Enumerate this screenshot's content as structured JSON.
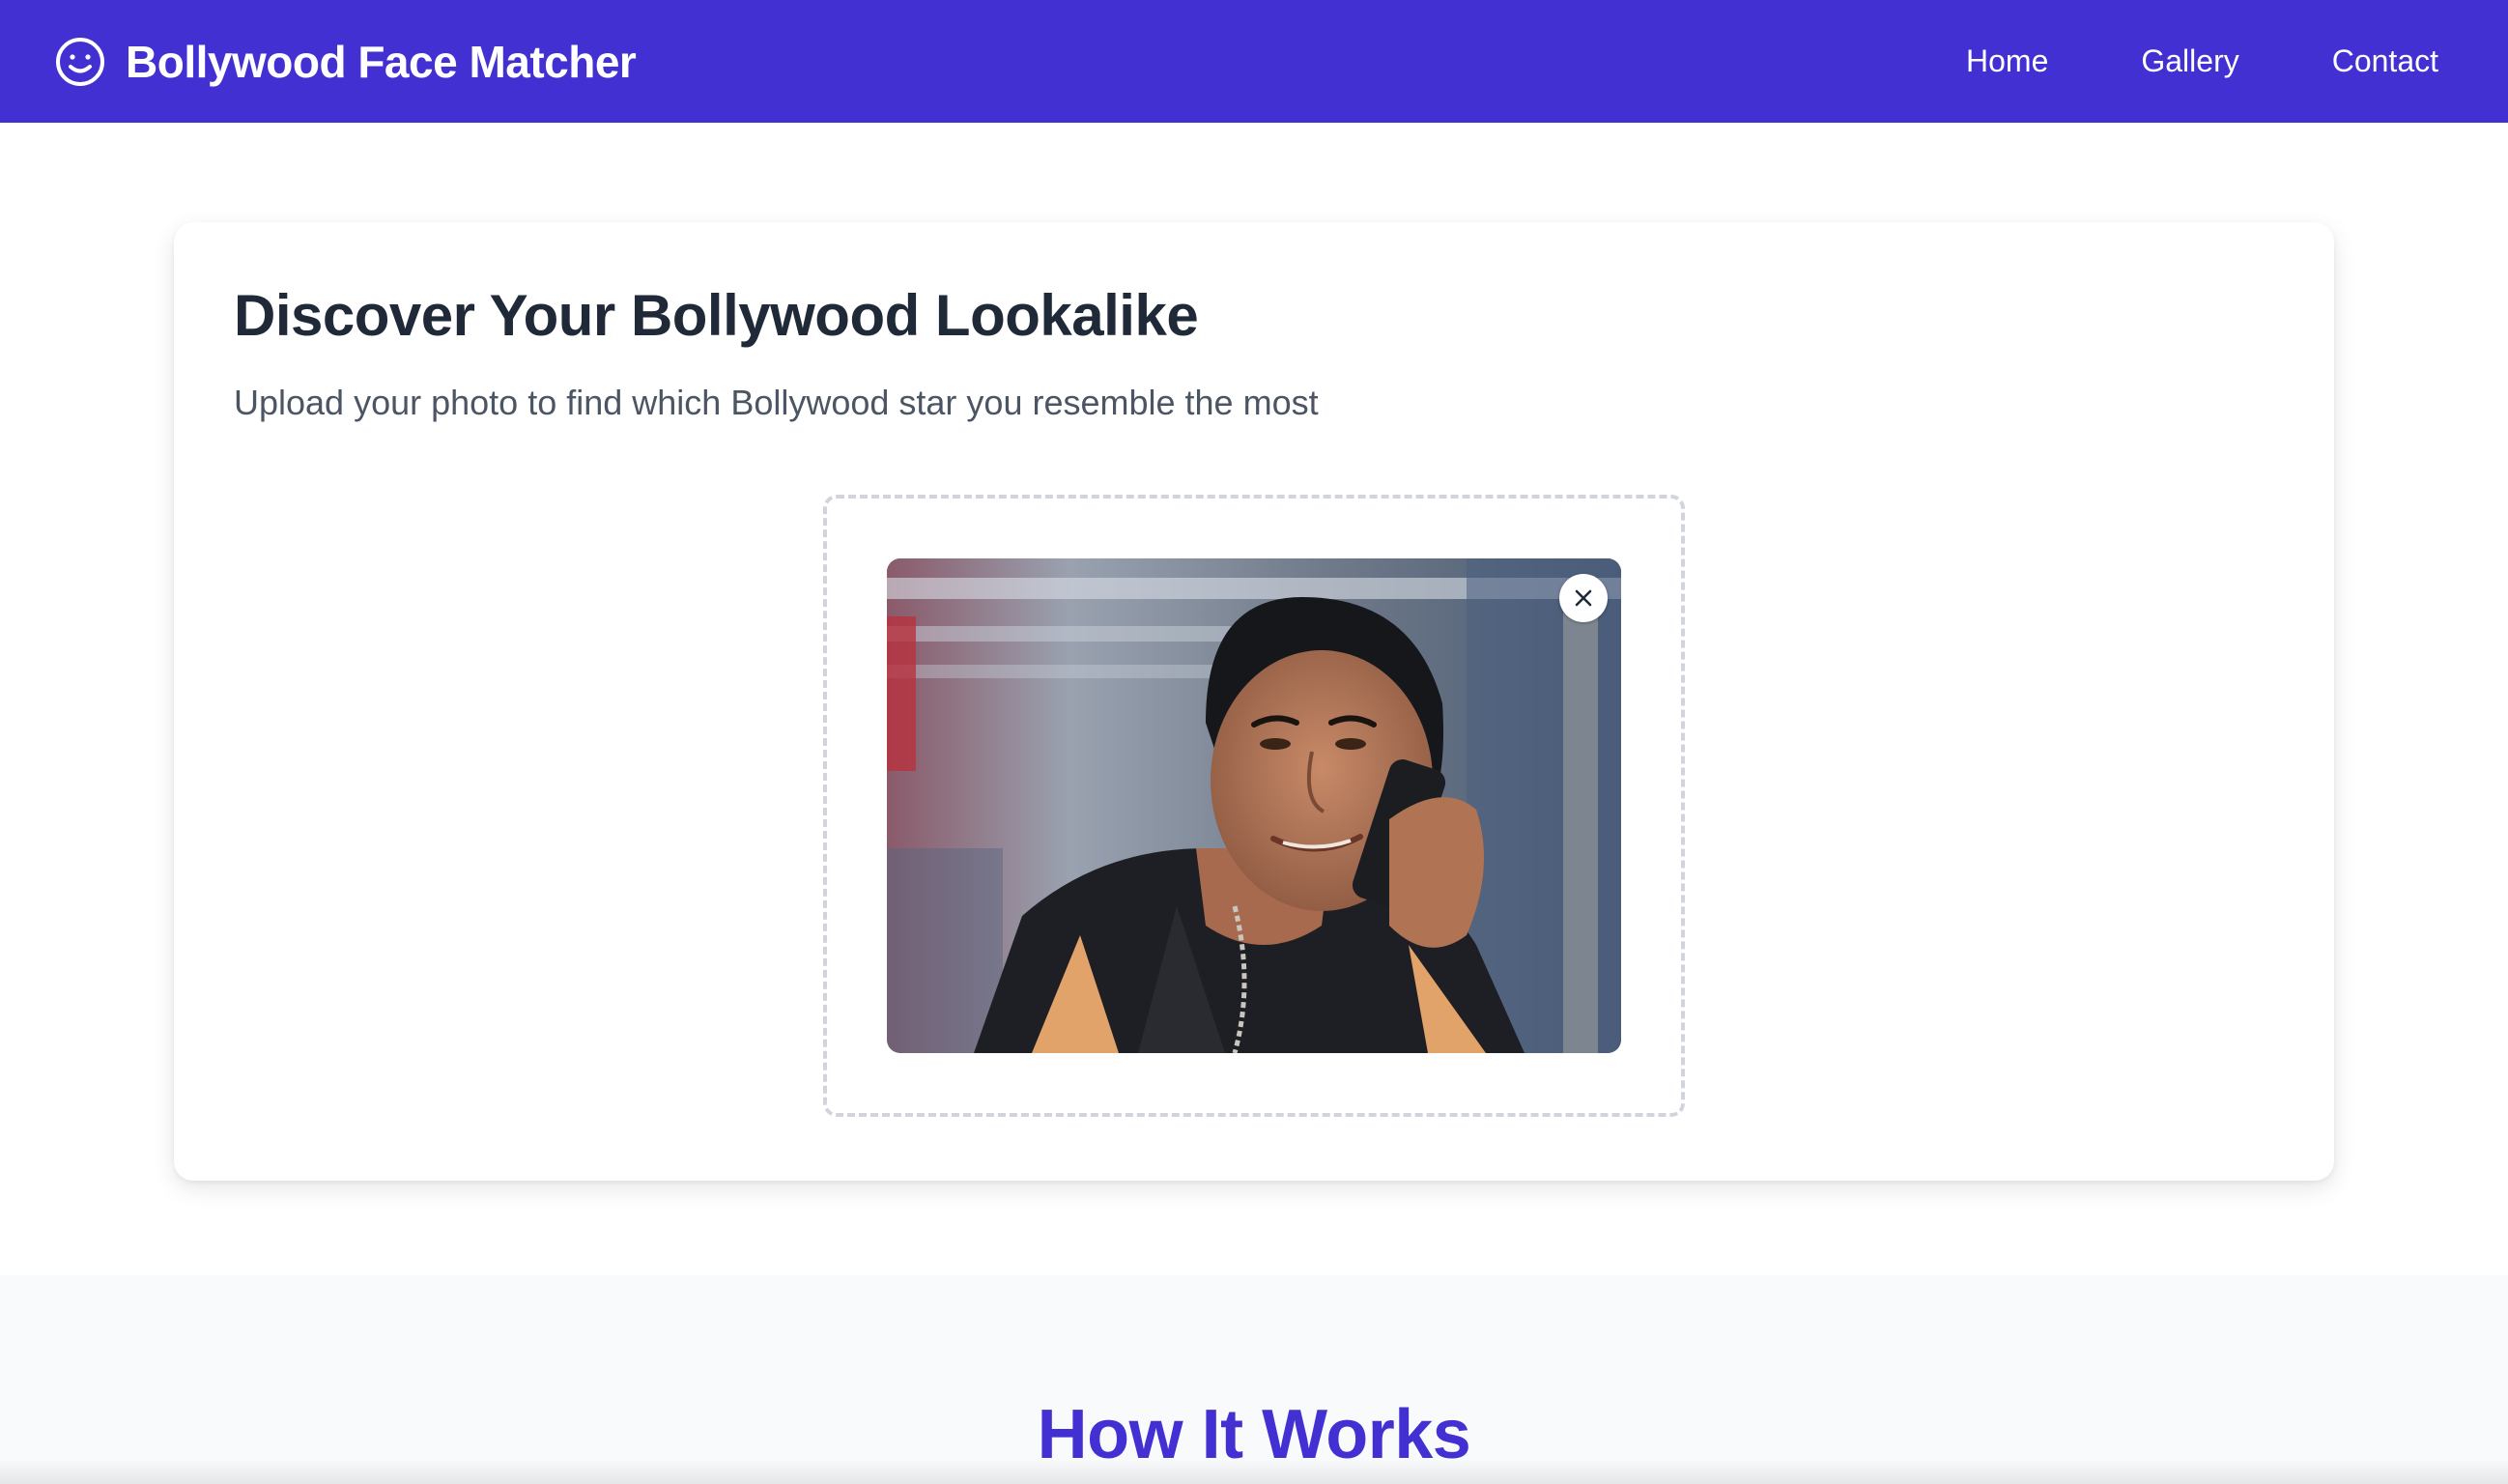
{
  "header": {
    "brand_title": "Bollywood Face Matcher",
    "brand_icon": "smiley-face-icon",
    "nav": [
      {
        "label": "Home"
      },
      {
        "label": "Gallery"
      },
      {
        "label": "Contact"
      }
    ]
  },
  "hero": {
    "title": "Discover Your Bollywood Lookalike",
    "subtitle": "Upload your photo to find which Bollywood star you resemble the most"
  },
  "upload": {
    "preview_icon": "uploaded-photo-preview",
    "remove_icon": "close-icon"
  },
  "how_it_works": {
    "title": "How It Works"
  },
  "colors": {
    "primary": "#4330d2",
    "heading": "#1f2937",
    "body_text": "#4b5563",
    "dropzone_border": "#d1d5db",
    "section_bg": "#f9fafb"
  }
}
